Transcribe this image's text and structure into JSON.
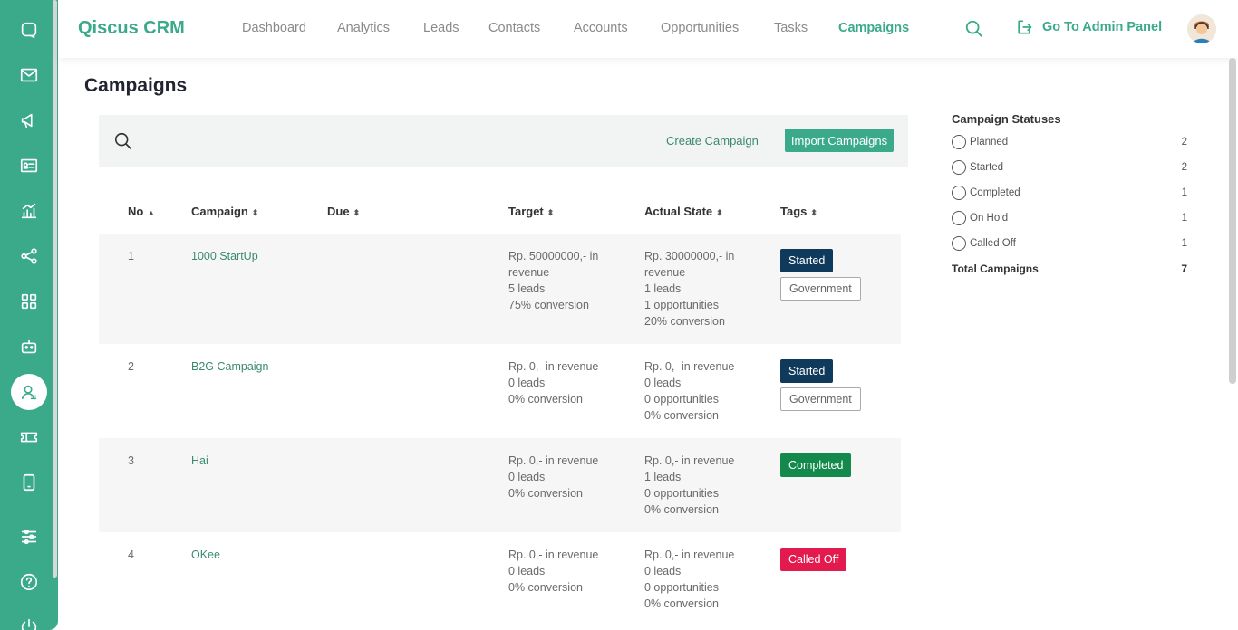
{
  "app": {
    "brand": "Qiscus CRM"
  },
  "nav": {
    "items": [
      "Dashboard",
      "Analytics",
      "Leads",
      "Contacts",
      "Accounts",
      "Opportunities",
      "Tasks",
      "Campaigns"
    ],
    "active": "Campaigns",
    "admin_label": "Go To Admin Panel"
  },
  "page": {
    "title": "Campaigns"
  },
  "toolbar": {
    "create_label": "Create Campaign",
    "import_label": "Import Campaigns"
  },
  "table": {
    "headers": [
      "No",
      "Campaign",
      "Due",
      "Target",
      "Actual State",
      "Tags"
    ],
    "rows": [
      {
        "no": "1",
        "campaign": "1000 StartUp",
        "due": "",
        "target": "Rp. 50000000,- in\nrevenue\n5 leads\n75% conversion",
        "actual": "Rp. 30000000,- in\nrevenue\n1 leads\n1 opportunities\n20% conversion",
        "status": "Started",
        "tag": "Government"
      },
      {
        "no": "2",
        "campaign": "B2G Campaign",
        "due": "",
        "target": "Rp. 0,- in revenue\n0 leads\n0% conversion",
        "actual": "Rp. 0,- in revenue\n0 leads\n0 opportunities\n0% conversion",
        "status": "Started",
        "tag": "Government"
      },
      {
        "no": "3",
        "campaign": "Hai",
        "due": "",
        "target": "Rp. 0,- in revenue\n0 leads\n0% conversion",
        "actual": "Rp. 0,- in revenue\n1 leads\n0 opportunities\n0% conversion",
        "status": "Completed",
        "tag": ""
      },
      {
        "no": "4",
        "campaign": "OKee",
        "due": "",
        "target": "Rp. 0,- in revenue\n0 leads\n0% conversion",
        "actual": "Rp. 0,- in revenue\n0 leads\n0 opportunities\n0% conversion",
        "status": "Called Off",
        "tag": ""
      }
    ]
  },
  "statuses": {
    "title": "Campaign Statuses",
    "items": [
      {
        "label": "Planned",
        "count": "2"
      },
      {
        "label": "Started",
        "count": "2"
      },
      {
        "label": "Completed",
        "count": "1"
      },
      {
        "label": "On Hold",
        "count": "1"
      },
      {
        "label": "Called Off",
        "count": "1"
      }
    ],
    "total_label": "Total Campaigns",
    "total": "7"
  },
  "colors": {
    "accent": "#3aaa8a",
    "started": "#0f3a5c",
    "completed": "#138a4c",
    "called_off": "#e21a4e"
  }
}
